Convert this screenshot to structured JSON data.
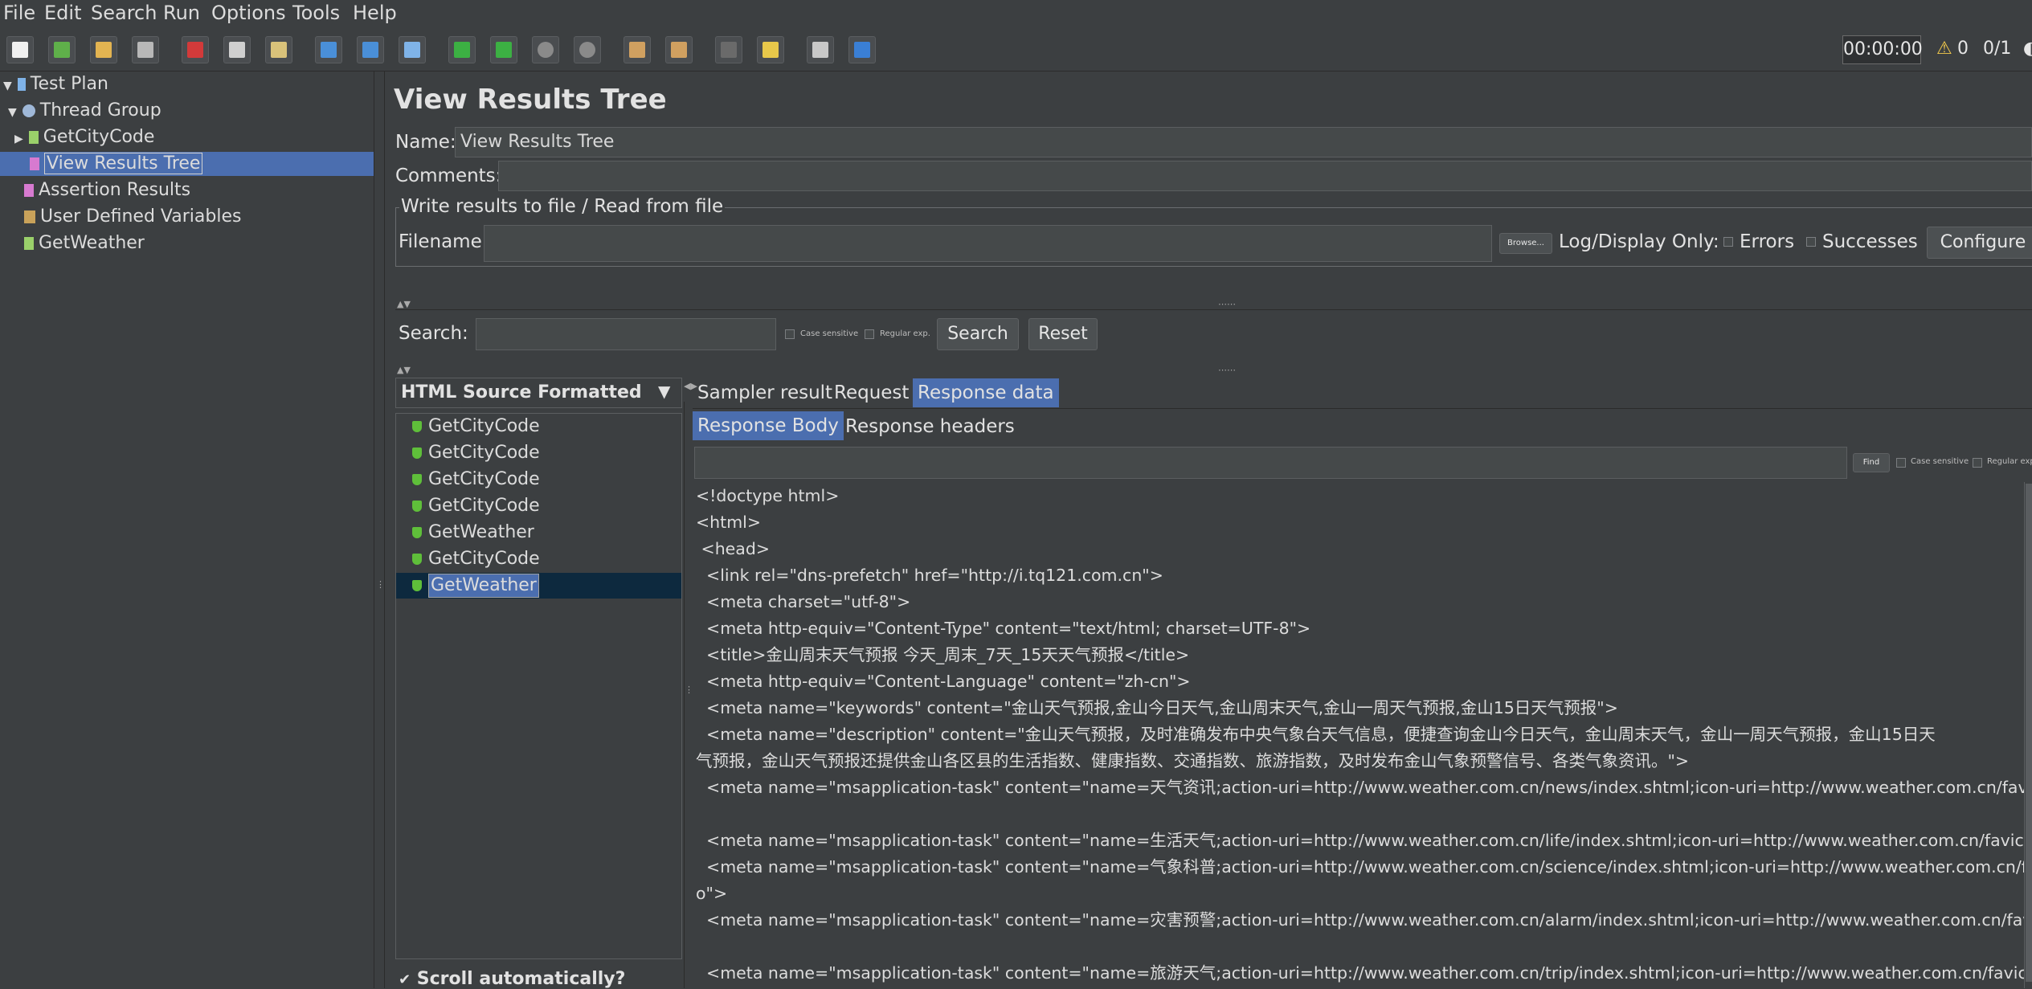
{
  "menu": [
    "File",
    "Edit",
    "Search",
    "Run",
    "Options",
    "Tools",
    "Help"
  ],
  "toolbar": {
    "timer": "00:00:00",
    "warning_count": "0",
    "threads": "0/1"
  },
  "tree": [
    {
      "label": "Test Plan",
      "icon": "test-plan-icon"
    },
    {
      "label": "Thread Group",
      "icon": "gear-icon"
    },
    {
      "label": "GetCityCode",
      "icon": "sampler-icon"
    },
    {
      "label": "View Results Tree",
      "icon": "listener-icon"
    },
    {
      "label": "Assertion Results",
      "icon": "listener-icon"
    },
    {
      "label": "User Defined Variables",
      "icon": "config-icon"
    },
    {
      "label": "GetWeather",
      "icon": "sampler-icon"
    }
  ],
  "panel": {
    "title": "View Results Tree",
    "name_label": "Name:",
    "name_value": "View Results Tree",
    "comments_label": "Comments:",
    "file_group_title": "Write results to file / Read from file",
    "filename_label": "Filename",
    "browse_label": "Browse...",
    "log_display_label": "Log/Display Only:",
    "errors_label": "Errors",
    "successes_label": "Successes",
    "configure_label": "Configure"
  },
  "search": {
    "label": "Search:",
    "case_sensitive": "Case sensitive",
    "regular_exp": "Regular exp.",
    "search_button": "Search",
    "reset_button": "Reset"
  },
  "renderer": {
    "selected": "HTML Source Formatted"
  },
  "results": [
    "GetCityCode",
    "GetCityCode",
    "GetCityCode",
    "GetCityCode",
    "GetWeather",
    "GetCityCode",
    "GetWeather"
  ],
  "scroll_auto_label": "Scroll automatically?",
  "tabs": {
    "sampler_result": "Sampler result",
    "request": "Request",
    "response_data": "Response data",
    "response_body": "Response Body",
    "response_headers": "Response headers"
  },
  "find": {
    "find_button": "Find",
    "case_sensitive": "Case sensitive",
    "regular_exp": "Regular exp"
  },
  "response_lines": [
    "<!doctype html>",
    "<html>",
    " <head>",
    "  <link rel=\"dns-prefetch\" href=\"http://i.tq121.com.cn\">",
    "  <meta charset=\"utf-8\">",
    "  <meta http-equiv=\"Content-Type\" content=\"text/html; charset=UTF-8\">",
    "  <title>金山周末天气预报 今天_周末_7天_15天天气预报</title>",
    "  <meta http-equiv=\"Content-Language\" content=\"zh-cn\">",
    "  <meta name=\"keywords\" content=\"金山天气预报,金山今日天气,金山周末天气,金山一周天气预报,金山15日天气预报\">",
    "  <meta name=\"description\" content=\"金山天气预报，及时准确发布中央气象台天气信息，便捷查询金山今日天气，金山周末天气，金山一周天气预报，金山15日天",
    "气预报，金山天气预报还提供金山各区县的生活指数、健康指数、交通指数、旅游指数，及时发布金山气象预警信号、各类气象资讯。\">",
    "  <meta name=\"msapplication-task\" content=\"name=天气资讯;action-uri=http://www.weather.com.cn/news/index.shtml;icon-uri=http://www.weather.com.cn/favicon.ico\">",
    "",
    "  <meta name=\"msapplication-task\" content=\"name=生活天气;action-uri=http://www.weather.com.cn/life/index.shtml;icon-uri=http://www.weather.com.cn/favicon.ico\">",
    "  <meta name=\"msapplication-task\" content=\"name=气象科普;action-uri=http://www.weather.com.cn/science/index.shtml;icon-uri=http://www.weather.com.cn/favicon.ic",
    "o\">",
    "  <meta name=\"msapplication-task\" content=\"name=灾害预警;action-uri=http://www.weather.com.cn/alarm/index.shtml;icon-uri=http://www.weather.com.cn/favicon.ico\">",
    "",
    "  <meta name=\"msapplication-task\" content=\"name=旅游天气;action-uri=http://www.weather.com.cn/trip/index.shtml;icon-uri=http://www.weather.com.cn/favicon.ico\">"
  ]
}
